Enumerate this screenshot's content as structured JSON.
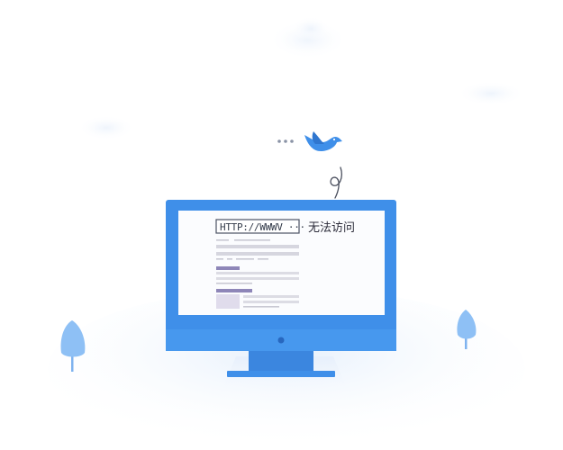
{
  "illustration": {
    "address_bar": {
      "url_text": "HTTP://WWWV ···"
    },
    "error_message": "无法访问",
    "colors": {
      "monitor_blue": "#3f8fe9",
      "stand_blue": "#3b86df",
      "screen_bg": "#fbfcfe",
      "placeholder_gray": "#d6d6df",
      "accent_purple": "#8e86b8",
      "bird_blue": "#3f8fe9",
      "tree_blue": "#8ec0f5"
    },
    "icons": [
      "bird-icon",
      "ellipsis-icon",
      "tree-left-icon",
      "tree-right-icon",
      "cloud-icon"
    ]
  }
}
